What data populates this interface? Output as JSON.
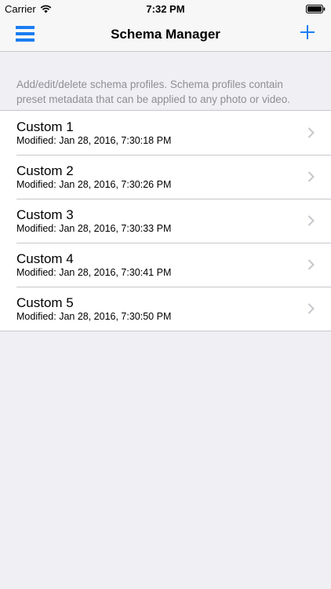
{
  "status_bar": {
    "carrier": "Carrier",
    "time": "7:32 PM",
    "wifi_icon": "wifi-icon",
    "battery_icon": "battery-icon",
    "battery_level": 1.0
  },
  "navbar": {
    "title": "Schema Manager",
    "menu_icon": "hamburger-menu-icon",
    "add_icon": "plus-icon"
  },
  "description": "Add/edit/delete schema profiles. Schema profiles contain preset metadata that can be applied to any photo or video.",
  "profiles": [
    {
      "name": "Custom 1",
      "modified": "Modified: Jan 28, 2016, 7:30:18 PM"
    },
    {
      "name": "Custom 2",
      "modified": "Modified: Jan 28, 2016, 7:30:26 PM"
    },
    {
      "name": "Custom 3",
      "modified": "Modified: Jan 28, 2016, 7:30:33 PM"
    },
    {
      "name": "Custom 4",
      "modified": "Modified: Jan 28, 2016, 7:30:41 PM"
    },
    {
      "name": "Custom 5",
      "modified": "Modified: Jan 28, 2016, 7:30:50 PM"
    }
  ],
  "colors": {
    "accent": "#1a7df2",
    "background": "#efeff4",
    "secondary_text": "#8e8e93",
    "chevron": "#c7c7cc"
  }
}
